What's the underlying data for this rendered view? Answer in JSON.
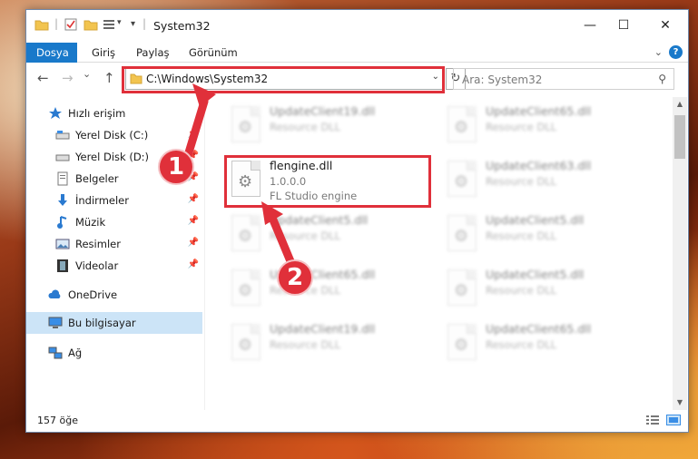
{
  "window": {
    "title": "System32",
    "controls": {
      "minimize": "—",
      "maximize": "☐",
      "close": "✕"
    }
  },
  "ribbon": {
    "tabs": [
      {
        "label": "Dosya",
        "active": true
      },
      {
        "label": "Giriş",
        "active": false
      },
      {
        "label": "Paylaş",
        "active": false
      },
      {
        "label": "Görünüm",
        "active": false
      }
    ],
    "help": "?"
  },
  "nav": {
    "back": "←",
    "forward": "→",
    "recent": "⌄",
    "up": "↑",
    "address": "C:\\Windows\\System32",
    "search_placeholder": "Ara: System32"
  },
  "sidebar": {
    "items": [
      {
        "label": "Hızlı erişim",
        "icon": "star-icon",
        "pinned": false
      },
      {
        "label": "Yerel Disk (C:)",
        "icon": "drive-icon",
        "pinned": true
      },
      {
        "label": "Yerel Disk (D:)",
        "icon": "drive-icon",
        "pinned": true
      },
      {
        "label": "Belgeler",
        "icon": "documents-icon",
        "pinned": true
      },
      {
        "label": "İndirmeler",
        "icon": "download-icon",
        "pinned": true
      },
      {
        "label": "Müzik",
        "icon": "music-icon",
        "pinned": true
      },
      {
        "label": "Resimler",
        "icon": "pictures-icon",
        "pinned": true
      },
      {
        "label": "Videolar",
        "icon": "video-icon",
        "pinned": true
      },
      {
        "label": "OneDrive",
        "icon": "cloud-icon",
        "pinned": false
      },
      {
        "label": "Bu bilgisayar",
        "icon": "computer-icon",
        "pinned": false,
        "selected": true
      },
      {
        "label": "Ağ",
        "icon": "network-icon",
        "pinned": false
      }
    ]
  },
  "files": {
    "highlighted": {
      "name": "flengine.dll",
      "version": "1.0.0.0",
      "description": "FL Studio engine"
    },
    "left_column": [
      {
        "name": "UpdateClient19.dll",
        "description": "Resource DLL"
      },
      {
        "name": "UpdateClient5.dll",
        "description": "Resource DLL"
      },
      {
        "name": "UpdateClient65.dll",
        "description": "Resource DLL"
      },
      {
        "name": "UpdateClient19.dll",
        "description": "Resource DLL"
      }
    ],
    "right_column": [
      {
        "name": "UpdateClient65.dll",
        "description": "Resource DLL"
      },
      {
        "name": "UpdateClient63.dll",
        "description": "Resource DLL"
      },
      {
        "name": "UpdateClient5.dll",
        "description": "Resource DLL"
      },
      {
        "name": "UpdateClient5.dll",
        "description": "Resource DLL"
      },
      {
        "name": "UpdateClient65.dll",
        "description": "Resource DLL"
      }
    ]
  },
  "status": {
    "item_count": "157 öğe"
  },
  "callouts": {
    "step1": "1",
    "step2": "2"
  },
  "colors": {
    "accent": "#1979ca",
    "highlight": "#e0303a",
    "selection": "#cce4f7"
  }
}
